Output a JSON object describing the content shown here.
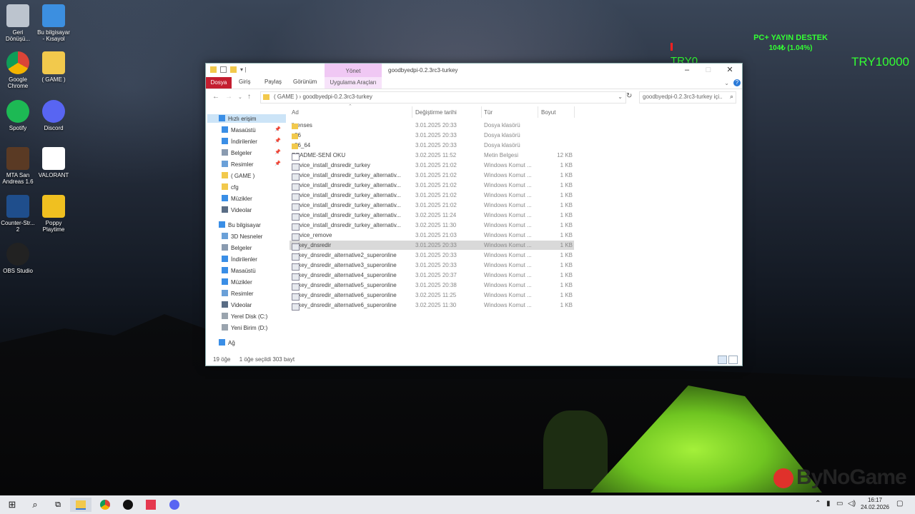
{
  "desktop": {
    "icons": [
      {
        "label": "Geri Dönüşü...",
        "icon": "recycle-bin-icon"
      },
      {
        "label": "Bu bilgisayar - Kısayol",
        "icon": "this-pc-icon"
      },
      {
        "label": "Google Chrome",
        "icon": "chrome-icon"
      },
      {
        "label": "( GAME )",
        "icon": "folder-icon"
      },
      {
        "label": "Spotify",
        "icon": "spotify-icon"
      },
      {
        "label": "Discord",
        "icon": "discord-icon"
      },
      {
        "label": "MTA San Andreas 1.6",
        "icon": "mta-icon"
      },
      {
        "label": "VALORANT",
        "icon": "valorant-icon"
      },
      {
        "label": "Counter-Str... 2",
        "icon": "cs2-icon"
      },
      {
        "label": "Poppy Playtime",
        "icon": "poppy-playtime-icon"
      },
      {
        "label": "OBS Studio",
        "icon": "obs-icon"
      }
    ]
  },
  "overlay": {
    "title": "PC+ YAYIN DESTEK",
    "amount": "104₺ (1.04%)",
    "progress_fraction": 0.0104,
    "min_label": "TRY0",
    "max_label": "TRY10000",
    "color": "#33ff33",
    "bar_color": "#ff2020"
  },
  "explorer": {
    "title": "goodbyedpi-0.2.3rc3-turkey",
    "context_tab": "Yönet",
    "ribbon_tabs": [
      "Dosya",
      "Giriş",
      "Paylaş",
      "Görünüm"
    ],
    "context_subtab": "Uygulama Araçları",
    "address": "( GAME )  ›  goodbyedpi-0.2.3rc3-turkey",
    "search_placeholder": "goodbyedpi-0.2.3rc3-turkey içi...",
    "columns": [
      "Ad",
      "Değiştirme tarihi",
      "Tür",
      "Boyut"
    ],
    "nav": {
      "quick_access": "Hızlı erişim",
      "quick_items": [
        {
          "label": "Masaüstü",
          "pinned": true
        },
        {
          "label": "İndirilenler",
          "pinned": true
        },
        {
          "label": "Belgeler",
          "pinned": true
        },
        {
          "label": "Resimler",
          "pinned": true
        },
        {
          "label": "( GAME )",
          "pinned": false
        },
        {
          "label": "cfg",
          "pinned": false
        },
        {
          "label": "Müzikler",
          "pinned": false
        },
        {
          "label": "Videolar",
          "pinned": false
        }
      ],
      "this_pc": "Bu bilgisayar",
      "pc_items": [
        "3D Nesneler",
        "Belgeler",
        "İndirilenler",
        "Masaüstü",
        "Müzikler",
        "Resimler",
        "Videolar",
        "Yerel Disk (C:)",
        "Yeni Birim (D:)"
      ],
      "network": "Ağ"
    },
    "files": [
      {
        "name": "licenses",
        "date": "3.01.2025 20:33",
        "type": "Dosya klasörü",
        "size": "",
        "kind": "folder"
      },
      {
        "name": "x86",
        "date": "3.01.2025 20:33",
        "type": "Dosya klasörü",
        "size": "",
        "kind": "folder"
      },
      {
        "name": "x86_64",
        "date": "3.01.2025 20:33",
        "type": "Dosya klasörü",
        "size": "",
        "kind": "folder"
      },
      {
        "name": "README-SENİ OKU",
        "date": "3.02.2025 11:52",
        "type": "Metin Belgesi",
        "size": "12 KB",
        "kind": "text"
      },
      {
        "name": "service_install_dnsredir_turkey",
        "date": "3.01.2025 21:02",
        "type": "Windows Komut ...",
        "size": "1 KB",
        "kind": "cmd"
      },
      {
        "name": "service_install_dnsredir_turkey_alternativ...",
        "date": "3.01.2025 21:02",
        "type": "Windows Komut ...",
        "size": "1 KB",
        "kind": "cmd"
      },
      {
        "name": "service_install_dnsredir_turkey_alternativ...",
        "date": "3.01.2025 21:02",
        "type": "Windows Komut ...",
        "size": "1 KB",
        "kind": "cmd"
      },
      {
        "name": "service_install_dnsredir_turkey_alternativ...",
        "date": "3.01.2025 21:02",
        "type": "Windows Komut ...",
        "size": "1 KB",
        "kind": "cmd"
      },
      {
        "name": "service_install_dnsredir_turkey_alternativ...",
        "date": "3.01.2025 21:02",
        "type": "Windows Komut ...",
        "size": "1 KB",
        "kind": "cmd"
      },
      {
        "name": "service_install_dnsredir_turkey_alternativ...",
        "date": "3.02.2025 11:24",
        "type": "Windows Komut ...",
        "size": "1 KB",
        "kind": "cmd"
      },
      {
        "name": "service_install_dnsredir_turkey_alternativ...",
        "date": "3.02.2025 11:30",
        "type": "Windows Komut ...",
        "size": "1 KB",
        "kind": "cmd"
      },
      {
        "name": "service_remove",
        "date": "3.01.2025 21:03",
        "type": "Windows Komut ...",
        "size": "1 KB",
        "kind": "cmd"
      },
      {
        "name": "turkey_dnsredir",
        "date": "3.01.2025 20:33",
        "type": "Windows Komut ...",
        "size": "1 KB",
        "kind": "cmd",
        "selected": true
      },
      {
        "name": "turkey_dnsredir_alternative2_superonline",
        "date": "3.01.2025 20:33",
        "type": "Windows Komut ...",
        "size": "1 KB",
        "kind": "cmd"
      },
      {
        "name": "turkey_dnsredir_alternative3_superonline",
        "date": "3.01.2025 20:33",
        "type": "Windows Komut ...",
        "size": "1 KB",
        "kind": "cmd"
      },
      {
        "name": "turkey_dnsredir_alternative4_superonline",
        "date": "3.01.2025 20:37",
        "type": "Windows Komut ...",
        "size": "1 KB",
        "kind": "cmd"
      },
      {
        "name": "turkey_dnsredir_alternative5_superonline",
        "date": "3.01.2025 20:38",
        "type": "Windows Komut ...",
        "size": "1 KB",
        "kind": "cmd"
      },
      {
        "name": "turkey_dnsredir_alternative6_superonline",
        "date": "3.02.2025 11:25",
        "type": "Windows Komut ...",
        "size": "1 KB",
        "kind": "cmd"
      },
      {
        "name": "turkey_dnsredir_alternative6_superonline",
        "date": "3.02.2025 11:30",
        "type": "Windows Komut ...",
        "size": "1 KB",
        "kind": "cmd"
      }
    ],
    "status_count": "19 öğe",
    "status_selected": "1 öğe seçildi  303 bayt"
  },
  "taskbar": {
    "time": "16:17",
    "date": "24.02.2026",
    "bg": "#e8eaee"
  },
  "watermark": "ByNoGame"
}
